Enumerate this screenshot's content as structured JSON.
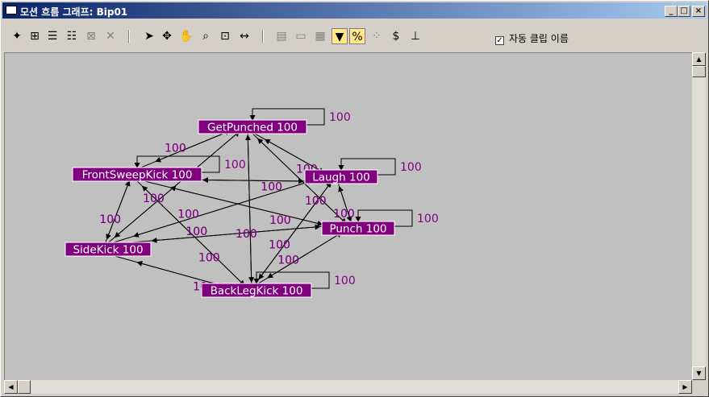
{
  "window": {
    "title": "모션 흐름 그래프: Bip01"
  },
  "title_buttons": {
    "minimize": "_",
    "maximize": "□",
    "close": "×"
  },
  "toolbar": {
    "tools": [
      {
        "name": "create-clip-icon",
        "glyph": "✦",
        "state": "normal"
      },
      {
        "name": "open-clip-icon",
        "glyph": "⊞",
        "state": "normal"
      },
      {
        "name": "create-transition-icon",
        "glyph": "☰",
        "state": "normal"
      },
      {
        "name": "add-transition-icon",
        "glyph": "☷",
        "state": "normal"
      },
      {
        "name": "optimize-icon",
        "glyph": "⊠",
        "state": "disabled"
      },
      {
        "name": "delete-icon",
        "glyph": "✕",
        "state": "disabled"
      },
      {
        "name": "select-arrow-icon",
        "glyph": "➤",
        "state": "normal"
      },
      {
        "name": "move-icon",
        "glyph": "✥",
        "state": "normal"
      },
      {
        "name": "pan-hand-icon",
        "glyph": "✋",
        "state": "normal"
      },
      {
        "name": "zoom-icon",
        "glyph": "⌕",
        "state": "normal"
      },
      {
        "name": "zoom-region-icon",
        "glyph": "⊡",
        "state": "normal"
      },
      {
        "name": "zoom-extents-icon",
        "glyph": "↔",
        "state": "normal"
      },
      {
        "name": "show-clip-icon",
        "glyph": "▤",
        "state": "disabled"
      },
      {
        "name": "clip-bar-icon",
        "glyph": "▭",
        "state": "disabled"
      },
      {
        "name": "properties-icon",
        "glyph": "▦",
        "state": "disabled"
      },
      {
        "name": "select-random-start-icon",
        "glyph": "▼",
        "state": "active"
      },
      {
        "name": "percent-icon",
        "glyph": "%",
        "state": "active"
      },
      {
        "name": "random-icon",
        "glyph": "⁘",
        "state": "disabled"
      },
      {
        "name": "dollar-icon",
        "glyph": "$",
        "state": "normal"
      },
      {
        "name": "script-icon",
        "glyph": "⊥",
        "state": "normal"
      }
    ]
  },
  "auto_clip_option": {
    "checked": true,
    "check_glyph": "✓",
    "label": "자동 클립 이름"
  },
  "graph": {
    "node_color": "#800080",
    "label_color": "#800080",
    "nodes": [
      {
        "id": "getpunched",
        "label": "GetPunched 100"
      },
      {
        "id": "frontsweepkick",
        "label": "FrontSweepKick 100"
      },
      {
        "id": "laugh",
        "label": "Laugh 100"
      },
      {
        "id": "punch",
        "label": "Punch 100"
      },
      {
        "id": "sidekick",
        "label": "SideKick 100"
      },
      {
        "id": "backlegkick",
        "label": "BackLegKick 100"
      }
    ],
    "transitions": [
      {
        "from": "getpunched",
        "to": "getpunched",
        "value": "100"
      },
      {
        "from": "laugh",
        "to": "laugh",
        "value": "100"
      },
      {
        "from": "punch",
        "to": "punch",
        "value": "100"
      },
      {
        "from": "backlegkick",
        "to": "backlegkick",
        "value": "100"
      },
      {
        "from": "frontsweepkick",
        "to": "frontsweepkick",
        "value": "100"
      },
      {
        "from": "getpunched",
        "to": "frontsweepkick",
        "value": "100"
      },
      {
        "from": "frontsweepkick",
        "to": "getpunched",
        "value": "100"
      },
      {
        "from": "getpunched",
        "to": "laugh",
        "value": "100"
      },
      {
        "from": "laugh",
        "to": "getpunched",
        "value": "100"
      },
      {
        "from": "getpunched",
        "to": "punch",
        "value": "100"
      },
      {
        "from": "punch",
        "to": "getpunched",
        "value": "100"
      },
      {
        "from": "getpunched",
        "to": "sidekick",
        "value": "100"
      },
      {
        "from": "sidekick",
        "to": "getpunched",
        "value": "100"
      },
      {
        "from": "getpunched",
        "to": "backlegkick",
        "value": "100"
      },
      {
        "from": "backlegkick",
        "to": "getpunched",
        "value": "100"
      },
      {
        "from": "frontsweepkick",
        "to": "laugh",
        "value": "100"
      },
      {
        "from": "laugh",
        "to": "frontsweepkick",
        "value": "100"
      },
      {
        "from": "frontsweepkick",
        "to": "punch",
        "value": "100"
      },
      {
        "from": "punch",
        "to": "frontsweepkick",
        "value": "100"
      },
      {
        "from": "frontsweepkick",
        "to": "sidekick",
        "value": "100"
      },
      {
        "from": "sidekick",
        "to": "frontsweepkick",
        "value": "100"
      },
      {
        "from": "frontsweepkick",
        "to": "backlegkick",
        "value": "100"
      },
      {
        "from": "backlegkick",
        "to": "frontsweepkick",
        "value": "100"
      },
      {
        "from": "laugh",
        "to": "punch",
        "value": "100"
      },
      {
        "from": "punch",
        "to": "laugh",
        "value": "100"
      },
      {
        "from": "laugh",
        "to": "sidekick",
        "value": "100"
      },
      {
        "from": "sidekick",
        "to": "laugh",
        "value": "100"
      },
      {
        "from": "laugh",
        "to": "backlegkick",
        "value": "100"
      },
      {
        "from": "backlegkick",
        "to": "laugh",
        "value": "100"
      },
      {
        "from": "punch",
        "to": "sidekick",
        "value": "100"
      },
      {
        "from": "sidekick",
        "to": "punch",
        "value": "100"
      },
      {
        "from": "punch",
        "to": "backlegkick",
        "value": "100"
      },
      {
        "from": "backlegkick",
        "to": "punch",
        "value": "100"
      },
      {
        "from": "sidekick",
        "to": "backlegkick",
        "value": "100"
      },
      {
        "from": "backlegkick",
        "to": "sidekick",
        "value": "100"
      }
    ]
  }
}
